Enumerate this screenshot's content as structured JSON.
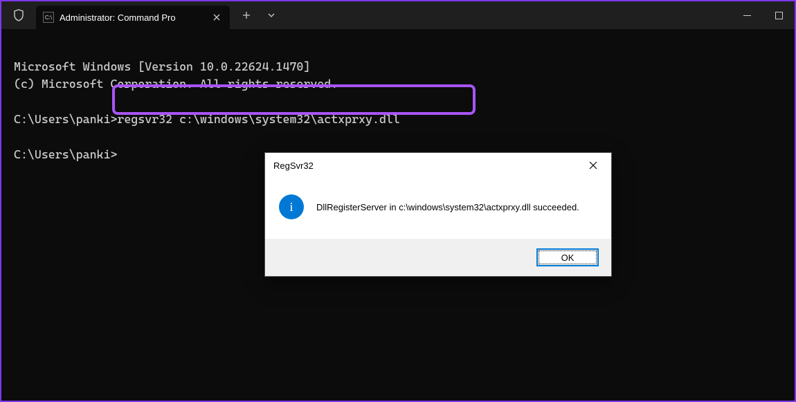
{
  "titlebar": {
    "tab_title": "Administrator: Command Pro",
    "tab_icon_text": "C:\\"
  },
  "terminal": {
    "line1": "Microsoft Windows [Version 10.0.22624.1470]",
    "line2": "(c) Microsoft Corporation. All rights reserved.",
    "blank1": "",
    "prompt1_path": "C:\\Users\\panki>",
    "prompt1_cmd": "regsvr32 c:\\windows\\system32\\actxprxy.dll",
    "blank2": "",
    "prompt2": "C:\\Users\\panki>"
  },
  "dialog": {
    "title": "RegSvr32",
    "message": "DllRegisterServer in c:\\windows\\system32\\actxprxy.dll succeeded.",
    "ok_label": "OK"
  }
}
